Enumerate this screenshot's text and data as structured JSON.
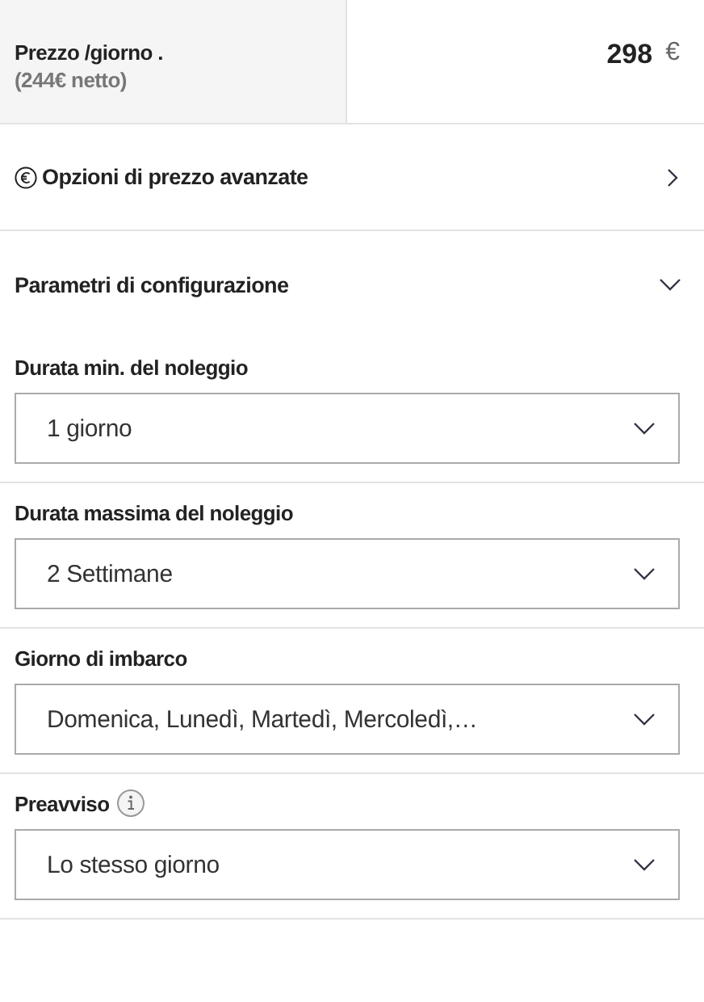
{
  "price": {
    "label": "Prezzo /giorno .",
    "net": "(244€ netto)",
    "amount": "298",
    "currency": "€"
  },
  "advanced": {
    "label": "Opzioni di prezzo avanzate",
    "expanded": false
  },
  "config": {
    "label": "Parametri di configurazione",
    "expanded": true
  },
  "fields": [
    {
      "label": "Durata min. del noleggio",
      "value": "1 giorno",
      "info": false
    },
    {
      "label": "Durata massima del noleggio",
      "value": "2 Settimane",
      "info": false
    },
    {
      "label": "Giorno di imbarco",
      "value": "Domenica, Lunedì, Martedì, Mercoledì,…",
      "info": false
    },
    {
      "label": "Preavviso",
      "value": "Lo stesso giorno",
      "info": true
    }
  ]
}
